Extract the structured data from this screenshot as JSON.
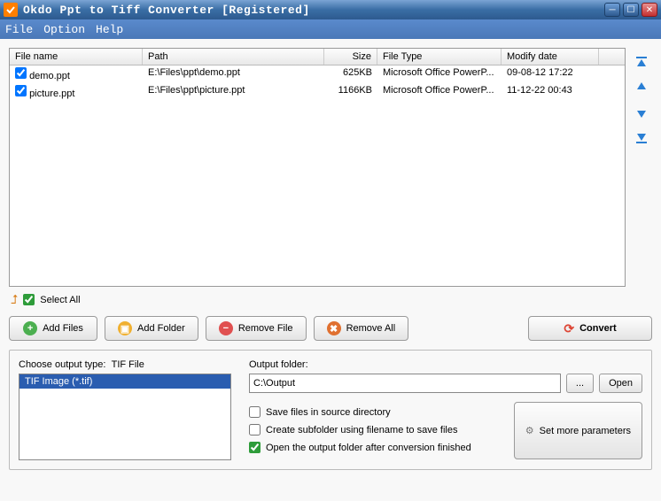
{
  "window": {
    "title": "Okdo Ppt to Tiff Converter [Registered]"
  },
  "menu": {
    "file": "File",
    "option": "Option",
    "help": "Help"
  },
  "table": {
    "headers": {
      "name": "File name",
      "path": "Path",
      "size": "Size",
      "type": "File Type",
      "date": "Modify date"
    },
    "rows": [
      {
        "name": "demo.ppt",
        "path": "E:\\Files\\ppt\\demo.ppt",
        "size": "625KB",
        "type": "Microsoft Office PowerP...",
        "date": "09-08-12 17:22"
      },
      {
        "name": "picture.ppt",
        "path": "E:\\Files\\ppt\\picture.ppt",
        "size": "1166KB",
        "type": "Microsoft Office PowerP...",
        "date": "11-12-22 00:43"
      }
    ]
  },
  "selectAll": "Select All",
  "buttons": {
    "addFiles": "Add Files",
    "addFolder": "Add Folder",
    "removeFile": "Remove File",
    "removeAll": "Remove All",
    "convert": "Convert"
  },
  "output": {
    "chooseTypeLabel": "Choose output type:",
    "typeValue": "TIF File",
    "listItem": "TIF Image (*.tif)",
    "folderLabel": "Output folder:",
    "folderValue": "C:\\Output",
    "browse": "...",
    "open": "Open",
    "saveSource": "Save files in source directory",
    "createSub": "Create subfolder using filename to save files",
    "openAfter": "Open the output folder after conversion finished",
    "moreParams": "Set more parameters"
  }
}
